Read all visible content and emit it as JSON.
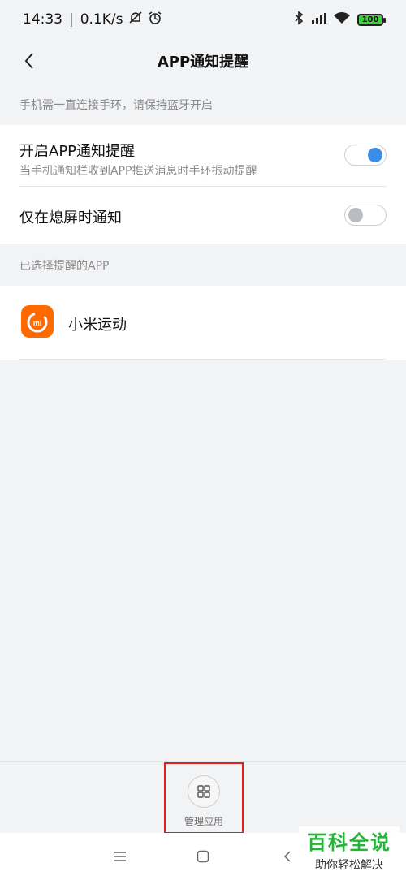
{
  "status_bar": {
    "time": "14:33",
    "net_speed": "0.1K/s",
    "battery": "100"
  },
  "header": {
    "title": "APP通知提醒"
  },
  "notice": {
    "text": "手机需一直连接手环，请保持蓝牙开启"
  },
  "settings": {
    "enable_title": "开启APP通知提醒",
    "enable_subtitle": "当手机通知栏收到APP推送消息时手环振动提醒",
    "enable_on": true,
    "screen_off_title": "仅在熄屏时通知",
    "screen_off_on": false
  },
  "selected_apps": {
    "section_label": "已选择提醒的APP",
    "apps": [
      {
        "name": "小米运动",
        "icon": "mi-fit-icon"
      }
    ]
  },
  "bottom": {
    "manage_label": "管理应用"
  },
  "watermark": {
    "main": "百科全说",
    "sub": "助你轻松解决"
  },
  "colors": {
    "toggle_on": "#3a8ee6",
    "app_icon_bg": "#ff6a00",
    "highlight_border": "#e02020",
    "watermark_green": "#26b33a"
  }
}
